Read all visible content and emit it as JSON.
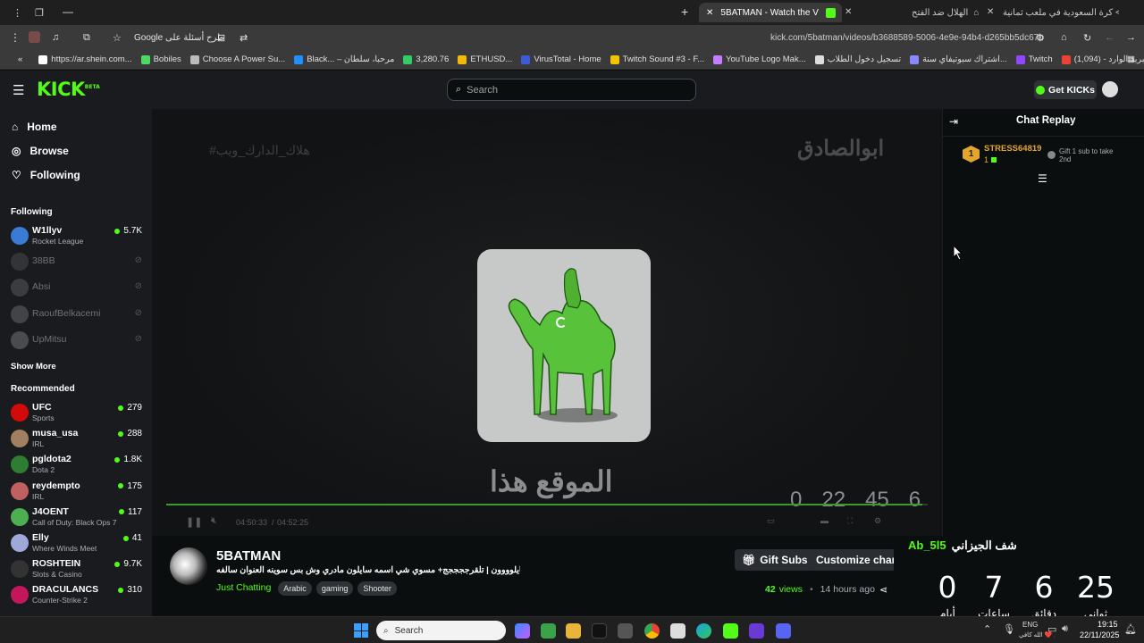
{
  "browser": {
    "tabs": [
      {
        "label": "كرة السعودية في ملعب ثمانية <",
        "active": false
      },
      {
        "label": "الهلال ضد الفتح",
        "active": false
      },
      {
        "label": "5BATMAN - Watch the VOD on",
        "active": true
      }
    ],
    "omnibox_label": "Google طرح أسئلة على",
    "url": "kick.com/5batman/videos/b3688589-5006-4e9e-94b4-d265bb5dc67b",
    "bookmarks": [
      {
        "label": "https://ar.shein.com...",
        "color": "#ffffff"
      },
      {
        "label": "Bobiles",
        "color": "#4cd964"
      },
      {
        "label": "Choose A Power Su...",
        "color": "#bbbbbb"
      },
      {
        "label": "Black... – مرحبا، سلطان",
        "color": "#1e90ff"
      },
      {
        "label": "3,280.76",
        "color": "#33cc66"
      },
      {
        "label": "ETHUSD...",
        "color": "#f0b90b"
      },
      {
        "label": "VirusTotal - Home",
        "color": "#3b5bdb"
      },
      {
        "label": "Twitch Sound #3 - F...",
        "color": "#f5c400"
      },
      {
        "label": "YouTube Logo Mak...",
        "color": "#c77dff"
      },
      {
        "label": "تسجيل دخول الطلاب",
        "color": "#dddddd"
      },
      {
        "label": "اشتراك سبوتيفاي سنة...",
        "color": "#8888ff"
      },
      {
        "label": "Twitch",
        "color": "#9146ff"
      },
      {
        "label": "البريد الوارد - (1,094)",
        "color": "#ea4335"
      },
      {
        "label": "YouTube",
        "color": "#ff0000"
      },
      {
        "label": "Netflix",
        "color": "#e50914"
      }
    ]
  },
  "header": {
    "logo": "KICK",
    "logo_badge": "BETA",
    "search_placeholder": "Search",
    "get_kicks": "Get KICKs"
  },
  "sidebar": {
    "nav": [
      {
        "label": "Home",
        "icon": "home-icon"
      },
      {
        "label": "Browse",
        "icon": "compass-icon"
      },
      {
        "label": "Following",
        "icon": "heart-icon"
      }
    ],
    "following_title": "Following",
    "following": [
      {
        "name": "W1llyv",
        "category": "Rocket League",
        "viewers": "5.7K",
        "live": true,
        "color": "#3a7bd5"
      },
      {
        "name": "38BB",
        "category": "",
        "viewers": "",
        "live": false,
        "color": "#555"
      },
      {
        "name": "Absi",
        "category": "",
        "viewers": "",
        "live": false,
        "color": "#666"
      },
      {
        "name": "RaoufBelkacemi",
        "category": "",
        "viewers": "",
        "live": false,
        "color": "#777"
      },
      {
        "name": "UpMitsu",
        "category": "",
        "viewers": "",
        "live": false,
        "color": "#888"
      }
    ],
    "show_more": "Show More",
    "recommended_title": "Recommended",
    "recommended": [
      {
        "name": "UFC",
        "category": "Sports",
        "viewers": "279",
        "color": "#d20a0a"
      },
      {
        "name": "musa_usa",
        "category": "IRL",
        "viewers": "288",
        "color": "#a08060"
      },
      {
        "name": "pgldota2",
        "category": "Dota 2",
        "viewers": "1.8K",
        "color": "#2e7d32"
      },
      {
        "name": "reydempto",
        "category": "IRL",
        "viewers": "175",
        "color": "#c06060"
      },
      {
        "name": "J4OENT",
        "category": "Call of Duty: Black Ops 7",
        "viewers": "117",
        "color": "#4caf50"
      },
      {
        "name": "Elly",
        "category": "Where Winds Meet",
        "viewers": "41",
        "color": "#9fa8da"
      },
      {
        "name": "ROSHTEIN",
        "category": "Slots & Casino",
        "viewers": "9.7K",
        "color": "#333333"
      },
      {
        "name": "DRACULANCS",
        "category": "Counter-Strike 2",
        "viewers": "310",
        "color": "#c2185b"
      }
    ]
  },
  "video": {
    "watermark_left": "#هلاك_الدارك_ويب",
    "watermark_right": "ابوالصادق",
    "caption": "الموقع هذا",
    "overlay_numbers": [
      "0",
      "22",
      "45",
      "6"
    ],
    "time_current": "04:50:33",
    "time_total": "04:52:25",
    "progress": 0.993
  },
  "channel": {
    "name": "5BATMAN",
    "title": "مكملييين سايلوووون | تلقرججججج+ مسوي شي اسمه سايلون مادري وش بس سوينه العنوان سالفه",
    "category": "Just Chatting",
    "tags": [
      "Arabic",
      "gaming",
      "Shooter"
    ],
    "views_count": "42",
    "views_label": "views",
    "time_ago": "14 hours ago",
    "gift_subs": "Gift Subs",
    "customize": "Customize channel"
  },
  "chat": {
    "title": "Chat Replay",
    "gifter_rank": "1",
    "gifter_name": "STRESS64819",
    "gifter_count": "1",
    "gift_prompt": "Gift 1 sub to take 2nd"
  },
  "countdown": {
    "header_arabic": "شف الجيزاني",
    "header_handle": "Ab_5l5",
    "items": [
      {
        "value": "0",
        "unit": "أيام"
      },
      {
        "value": "7",
        "unit": "ساعات"
      },
      {
        "value": "6",
        "unit": "دقائق"
      },
      {
        "value": "25",
        "unit": "ثواني"
      }
    ]
  },
  "taskbar": {
    "search_placeholder": "Search",
    "lang": "ENG",
    "lang_sub": "شفع ❤️ الله كافي",
    "time": "19:15",
    "date": "22/11/2025"
  }
}
